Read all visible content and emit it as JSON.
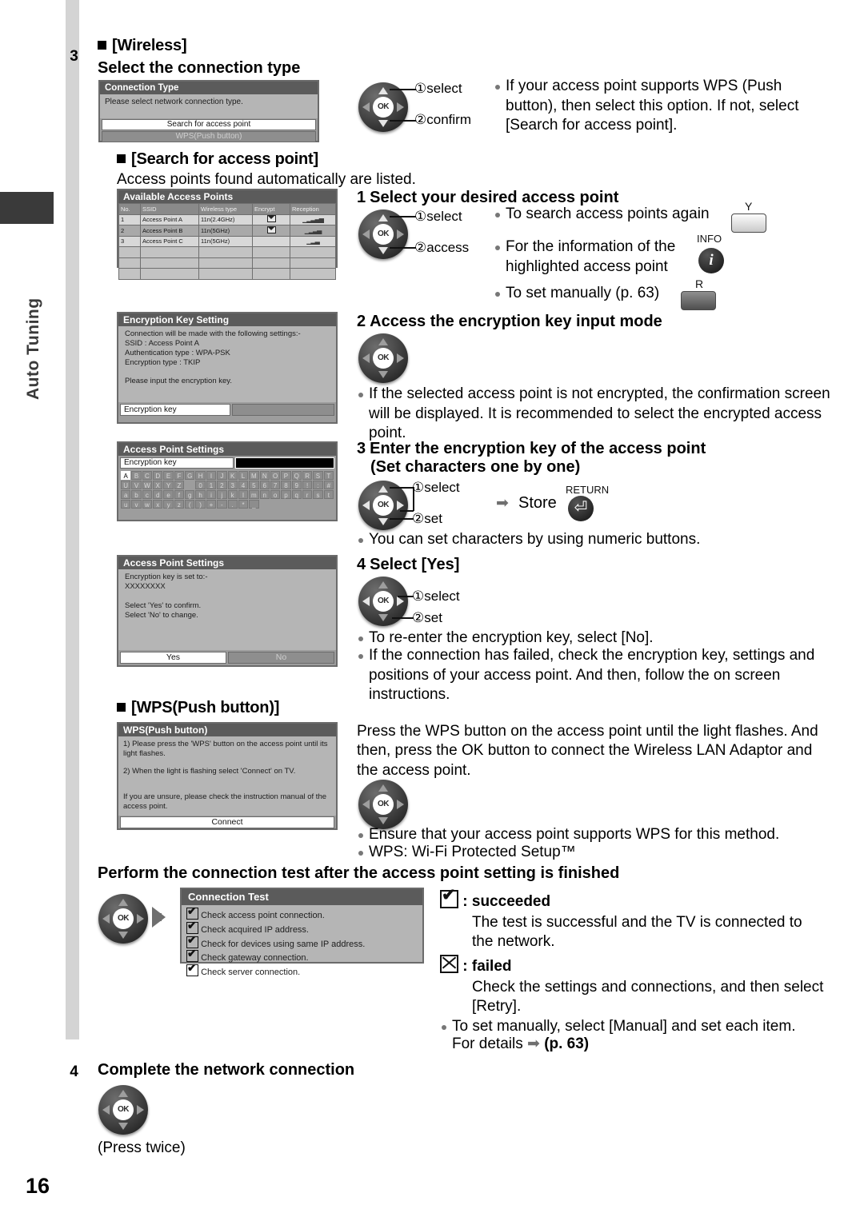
{
  "page": {
    "number": "16",
    "side_tab_label": "Auto Tuning"
  },
  "step3": {
    "number": "3",
    "heading_bracket": "[Wireless]",
    "heading_sub": "Select the connection type",
    "dpad": {
      "label1": "select",
      "label2": "confirm",
      "ok": "OK"
    },
    "note": "If your access point supports WPS (Push button), then select this option. If not, select [Search for access point]."
  },
  "connection_type_screen": {
    "title": "Connection Type",
    "message": "Please select network connection type.",
    "options": [
      "Search for access point",
      "WPS(Push button)"
    ]
  },
  "search_section": {
    "heading": "[Search for access point]",
    "subtext": "Access points found automatically are listed."
  },
  "access_points_screen": {
    "title": "Available Access Points",
    "columns": [
      "No.",
      "SSID",
      "Wireless type",
      "Encrypt",
      "Reception"
    ],
    "rows": [
      {
        "no": "1",
        "ssid": "Access Point A",
        "type": "11n(2.4GHz)",
        "encrypt": "locked",
        "reception": "5"
      },
      {
        "no": "2",
        "ssid": "Access Point B",
        "type": "11n(5GHz)",
        "encrypt": "locked",
        "reception": "4"
      },
      {
        "no": "3",
        "ssid": "Access Point C",
        "type": "11n(5GHz)",
        "encrypt": "",
        "reception": "3"
      }
    ],
    "blank_rows": 3
  },
  "sub1": {
    "number": "1",
    "heading": "Select your desired access point",
    "dpad": {
      "label1": "select",
      "label2": "access",
      "ok": "OK"
    },
    "bullets": [
      {
        "text": "To search access points again",
        "key": "Y",
        "key_type": "yellow"
      },
      {
        "text": "For the information of the highlighted access point",
        "key": "INFO",
        "key_type": "info"
      },
      {
        "text": "To set manually (p. 63)",
        "key": "R",
        "key_type": "red"
      }
    ]
  },
  "sub2": {
    "number": "2",
    "heading": "Access the encryption key input mode",
    "ok": "OK",
    "note": "If the selected access point is not encrypted, the confirmation screen will be displayed. It is recommended to select the encrypted access point."
  },
  "encryption_key_screen": {
    "title": "Encryption Key Setting",
    "lines": [
      "Connection will be made with the following settings:-",
      "SSID : Access Point A",
      "Authentication type : WPA-PSK",
      "Encryption type : TKIP",
      "",
      "Please input the encryption key."
    ],
    "field_label": "Encryption key",
    "field_value": ""
  },
  "sub3": {
    "number": "3",
    "heading_line1": "Enter the encryption key of the access point",
    "heading_line2": "(Set characters one by one)",
    "dpad": {
      "label1": "select",
      "label2": "set",
      "ok": "OK"
    },
    "store_label": "Store",
    "return_label": "RETURN",
    "note": "You can set characters by using numeric buttons."
  },
  "keyboard_screen": {
    "title": "Access Point Settings",
    "field_label": "Encryption key",
    "field_value": "",
    "selected_key": "A",
    "rows": [
      [
        "A",
        "B",
        "C",
        "D",
        "E",
        "F",
        "G",
        "H",
        "I",
        "J",
        "K",
        "L",
        "M",
        "N",
        "O",
        "P",
        "Q",
        "R",
        "S",
        "T"
      ],
      [
        "U",
        "V",
        "W",
        "X",
        "Y",
        "Z",
        "",
        "0",
        "1",
        "2",
        "3",
        "4",
        "5",
        "6",
        "7",
        "8",
        "9",
        "!",
        ":",
        "#"
      ],
      [
        "a",
        "b",
        "c",
        "d",
        "e",
        "f",
        "g",
        "h",
        "i",
        "j",
        "k",
        "l",
        "m",
        "n",
        "o",
        "p",
        "q",
        "r",
        "s",
        "t"
      ],
      [
        "u",
        "v",
        "w",
        "x",
        "y",
        "z",
        "(",
        ")",
        "+",
        "-",
        ".",
        "*",
        "_",
        "",
        "",
        "",
        "",
        "",
        "",
        ""
      ]
    ]
  },
  "sub4": {
    "number": "4",
    "heading": "Select [Yes]",
    "dpad": {
      "label1": "select",
      "label2": "set",
      "ok": "OK"
    },
    "notes": [
      "To re-enter the encryption key, select [No].",
      "If the connection has failed, check the encryption key, settings and positions of your access point. And then, follow the on screen instructions."
    ]
  },
  "confirm_screen": {
    "title": "Access Point Settings",
    "lines": [
      "Encryption key is set to:-",
      "XXXXXXXX",
      "",
      "Select 'Yes' to confirm.",
      "Select 'No' to change."
    ],
    "buttons": [
      "Yes",
      "No"
    ]
  },
  "wps_section": {
    "heading": "[WPS(Push button)]",
    "paragraph": "Press the WPS button on the access point until the light flashes. And then, press the OK button to connect the Wireless LAN Adaptor and the access point.",
    "ok": "OK",
    "notes": [
      "Ensure that your access point supports WPS for this method.",
      "WPS: Wi-Fi Protected Setup™"
    ]
  },
  "wps_screen": {
    "title": "WPS(Push button)",
    "lines": [
      "1) Please press the 'WPS' button on the access point until its light flashes.",
      "",
      "2) When the light is flashing select 'Connect' on TV.",
      "",
      "",
      "If you are unsure, please check the instruction manual of the access point."
    ],
    "button": "Connect"
  },
  "connection_test": {
    "heading": "Perform the connection test after the access point setting is finished",
    "ok": "OK",
    "screen": {
      "title": "Connection Test",
      "items": [
        "Check access point connection.",
        "Check acquired IP address.",
        "Check for devices using same IP address.",
        "Check gateway connection.",
        "Check server connection."
      ]
    },
    "succeeded_label": ": succeeded",
    "succeeded_text": "The test is successful and the TV is connected to the network.",
    "failed_label": ": failed",
    "failed_text": "Check the settings and connections, and then select [Retry].",
    "manual_note": "To set manually, select [Manual] and set each item.",
    "details_label": "For details",
    "details_page": "(p. 63)"
  },
  "step4": {
    "number": "4",
    "heading": "Complete the network connection",
    "ok": "OK",
    "note": "(Press twice)"
  }
}
